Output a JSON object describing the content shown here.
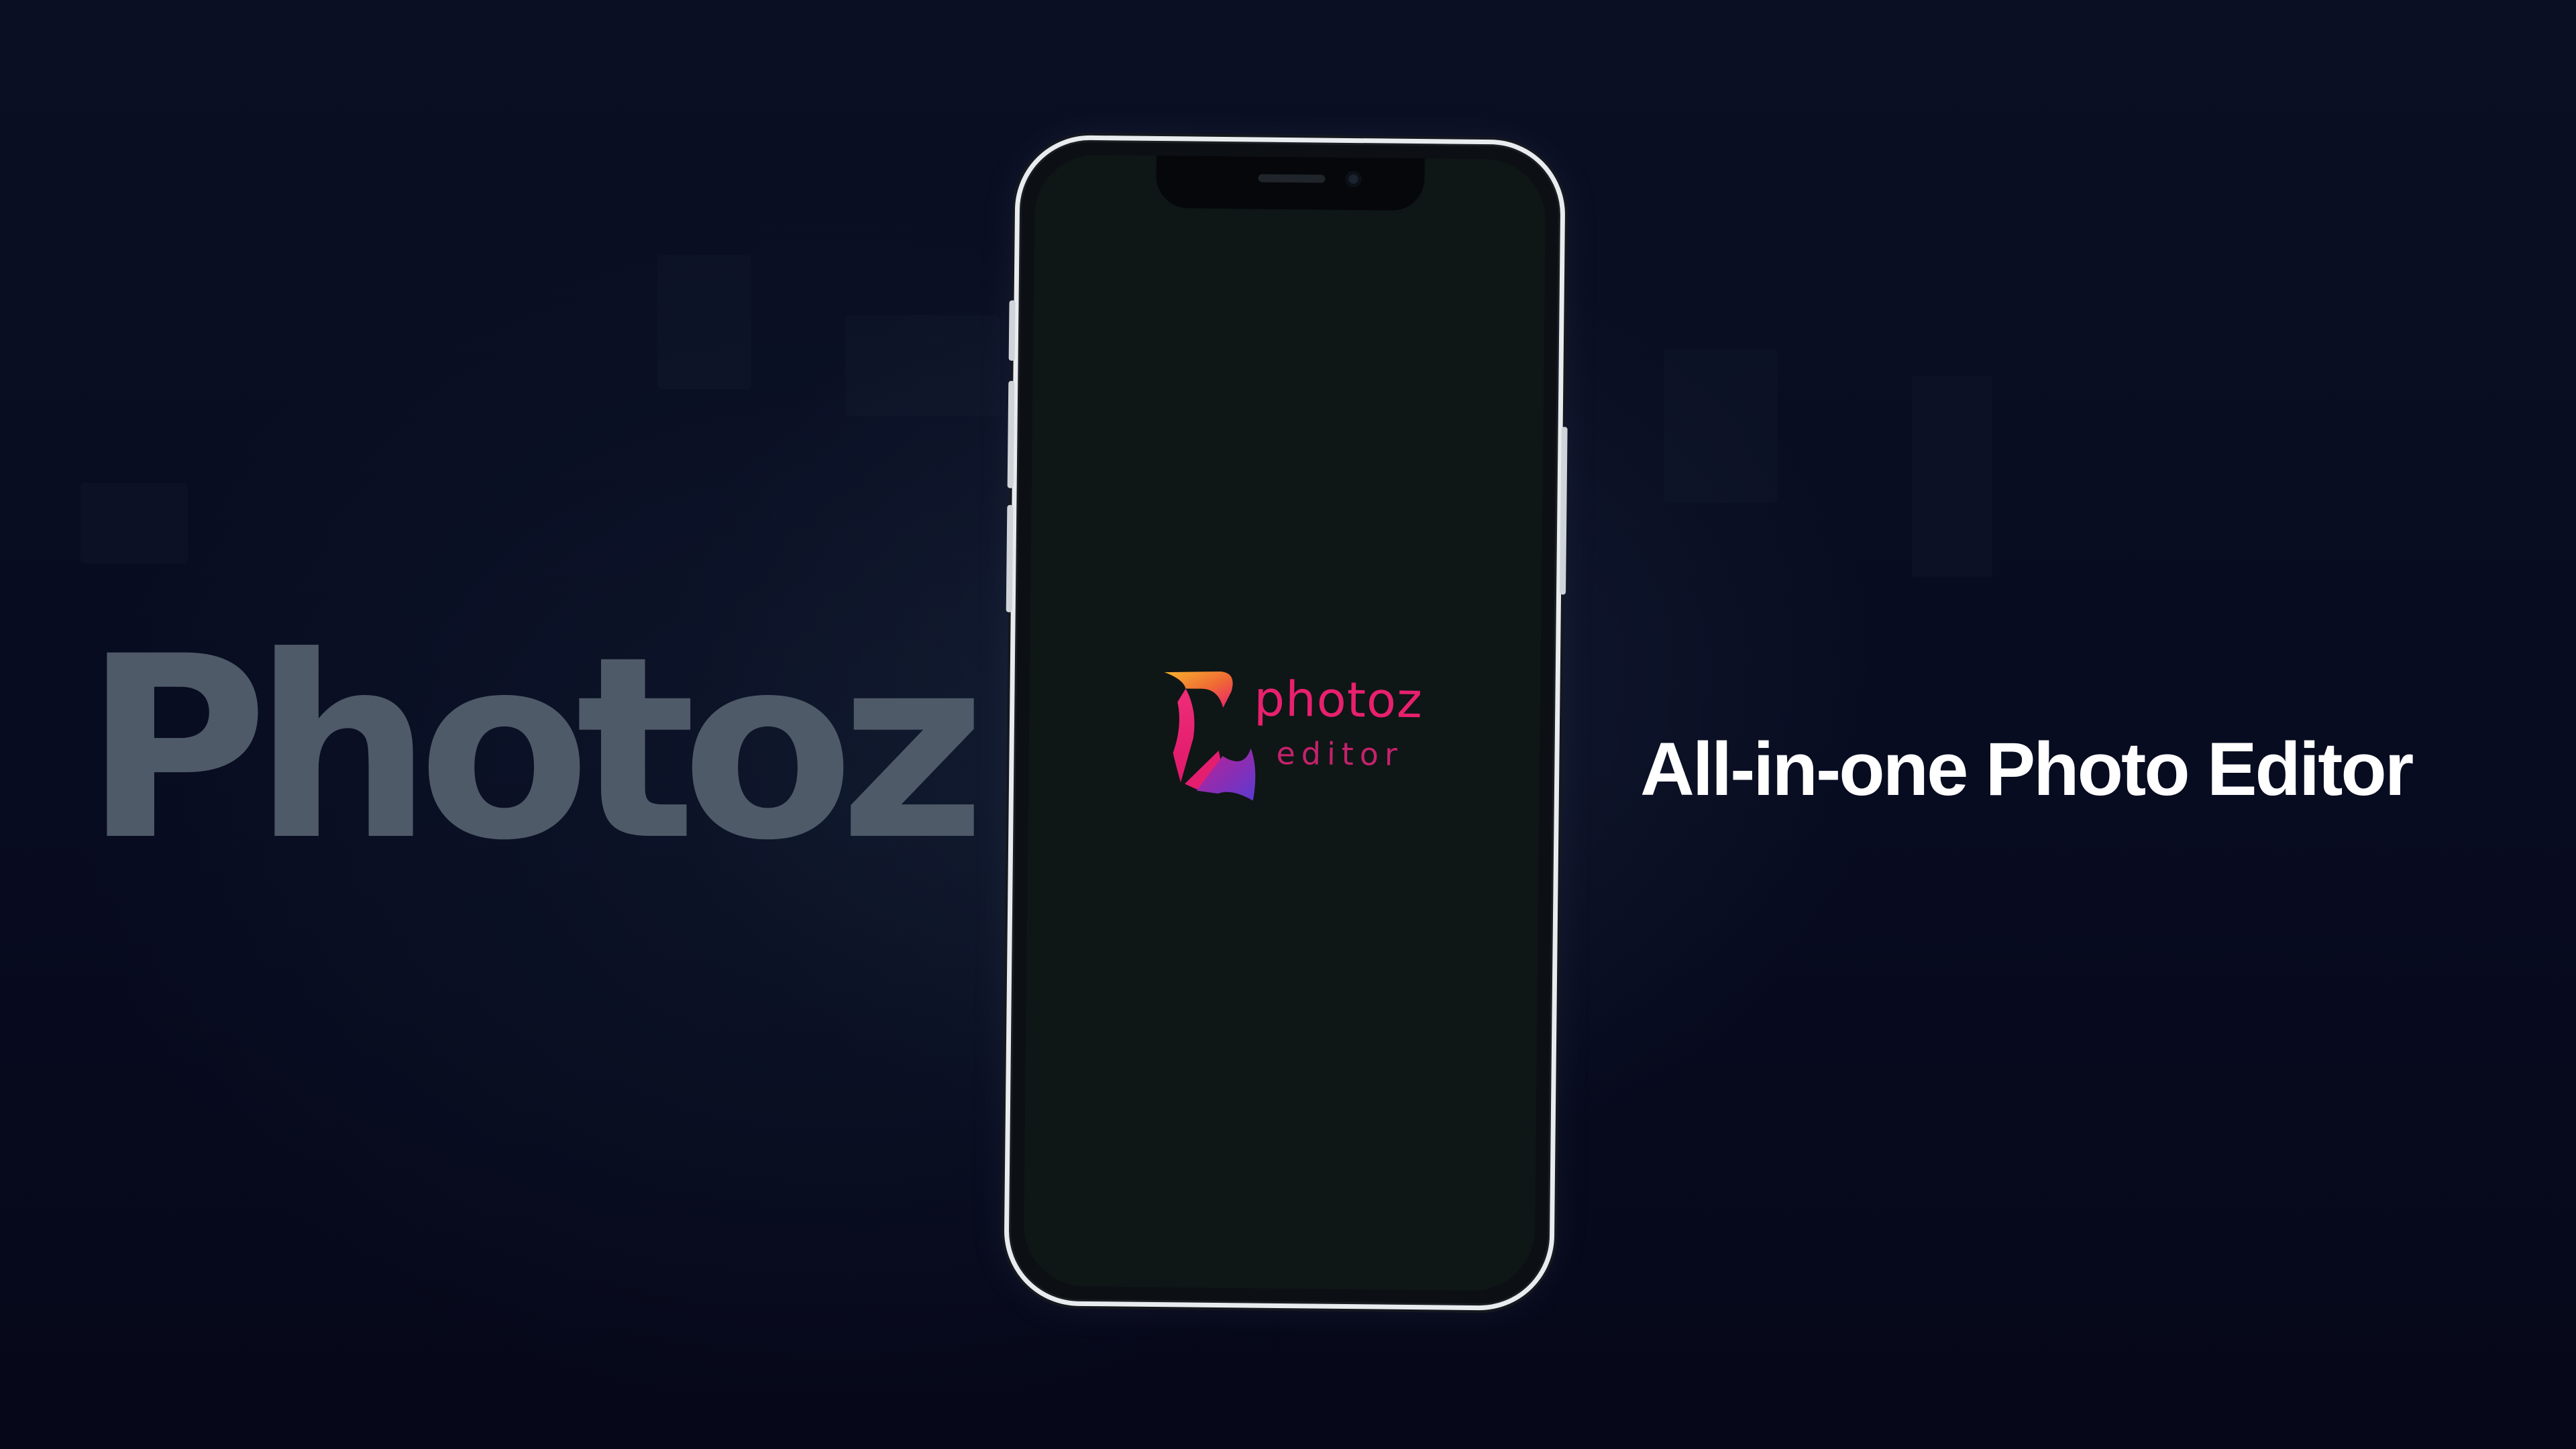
{
  "brand": {
    "word": "Photoz"
  },
  "tagline": {
    "text": "All-in-one Photo Editor"
  },
  "phone": {
    "logo_word": "photoz",
    "logo_sub": "editor",
    "logo_icon": "photoz-logo-icon"
  },
  "colors": {
    "background": "#070a1c",
    "brand_word": "#4f5a68",
    "tagline": "#ffffff",
    "logo_pink": "#e8206e",
    "logo_orange": "#f59a2a",
    "logo_purple": "#6a3fd0"
  }
}
